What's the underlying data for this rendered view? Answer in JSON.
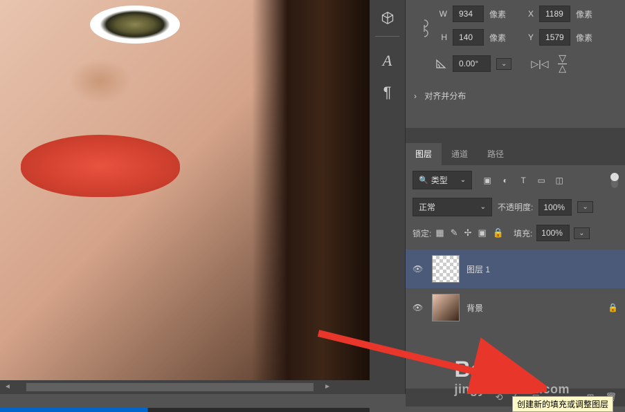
{
  "transform": {
    "w_label": "W",
    "w_value": "934",
    "w_unit": "像素",
    "h_label": "H",
    "h_value": "140",
    "h_unit": "像素",
    "x_label": "X",
    "x_value": "1189",
    "x_unit": "像素",
    "y_label": "Y",
    "y_value": "1579",
    "y_unit": "像素",
    "angle_value": "0.00°"
  },
  "align_section": {
    "label": "对齐并分布"
  },
  "panels": {
    "tabs": {
      "layers": "图层",
      "channels": "通道",
      "paths": "路径"
    }
  },
  "layer_filter": {
    "type_label": "类型"
  },
  "blend": {
    "mode": "正常",
    "opacity_label": "不透明度:",
    "opacity_value": "100%"
  },
  "lock": {
    "label": "锁定:",
    "fill_label": "填充:",
    "fill_value": "100%"
  },
  "layers": [
    {
      "name": "图层 1",
      "selected": true,
      "transparent": true,
      "locked": false
    },
    {
      "name": "背景",
      "selected": false,
      "transparent": false,
      "locked": true
    }
  ],
  "tooltip": "创建新的填充或调整图层",
  "watermark": "jingyan.baidu.com"
}
